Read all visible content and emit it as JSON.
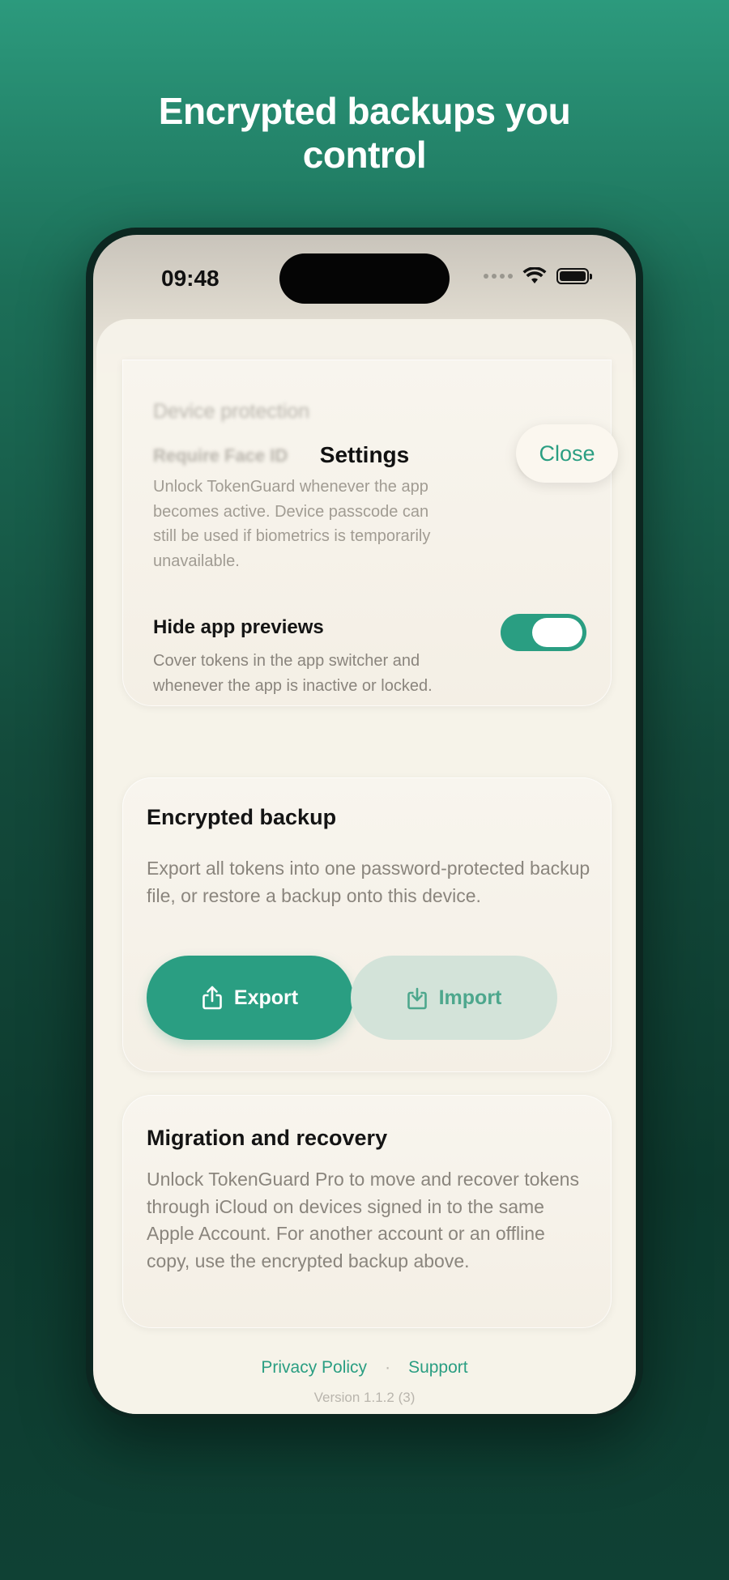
{
  "headline": {
    "line1": "Encrypted backups you",
    "line2": "control"
  },
  "status": {
    "time": "09:48"
  },
  "nav": {
    "title": "Settings",
    "close_label": "Close"
  },
  "device_protection": {
    "section_title": "Device protection",
    "face_id_label": "Require Face ID",
    "face_id_description": "Unlock TokenGuard whenever the app becomes active. Device passcode can still be used if biometrics is temporarily unavailable.",
    "hide_previews_label": "Hide app previews",
    "hide_previews_description": "Cover tokens in the app switcher and whenever the app is inactive or locked.",
    "hide_previews_on": true
  },
  "backup": {
    "title": "Encrypted backup",
    "description": "Export all tokens into one password-protected backup file, or restore a backup onto this device.",
    "export_label": "Export",
    "import_label": "Import"
  },
  "migration": {
    "title": "Migration and recovery",
    "description": "Unlock TokenGuard Pro to move and recover tokens through iCloud on devices signed in to the same Apple Account. For another account or an offline copy, use the encrypted backup above."
  },
  "footer": {
    "privacy_label": "Privacy Policy",
    "separator": "·",
    "support_label": "Support",
    "version": "Version 1.1.2 (3)"
  },
  "colors": {
    "accent": "#2a9e82",
    "background": "#134a3b",
    "sheet": "#f5f0e6"
  }
}
